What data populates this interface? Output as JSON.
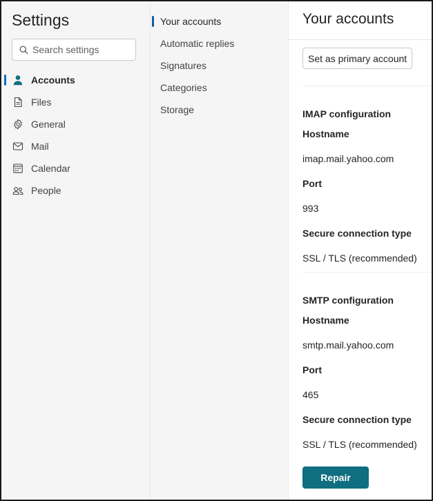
{
  "settings": {
    "title": "Settings",
    "search_placeholder": "Search settings",
    "nav": [
      {
        "label": "Accounts",
        "icon": "person-icon",
        "active": true
      },
      {
        "label": "Files",
        "icon": "file-icon"
      },
      {
        "label": "General",
        "icon": "gear-icon"
      },
      {
        "label": "Mail",
        "icon": "mail-icon"
      },
      {
        "label": "Calendar",
        "icon": "calendar-icon"
      },
      {
        "label": "People",
        "icon": "people-icon"
      }
    ]
  },
  "subnav": {
    "items": [
      {
        "label": "Your accounts",
        "active": true
      },
      {
        "label": "Automatic replies"
      },
      {
        "label": "Signatures"
      },
      {
        "label": "Categories"
      },
      {
        "label": "Storage"
      }
    ]
  },
  "main": {
    "title": "Your accounts",
    "primary_button": "Set as primary account",
    "imap": {
      "heading": "IMAP configuration",
      "hostname_label": "Hostname",
      "hostname": "imap.mail.yahoo.com",
      "port_label": "Port",
      "port": "993",
      "secure_label": "Secure connection type",
      "secure": "SSL / TLS (recommended)"
    },
    "smtp": {
      "heading": "SMTP configuration",
      "hostname_label": "Hostname",
      "hostname": "smtp.mail.yahoo.com",
      "port_label": "Port",
      "port": "465",
      "secure_label": "Secure connection type",
      "secure": "SSL / TLS (recommended)"
    },
    "repair_button": "Repair"
  },
  "colors": {
    "accent": "#0f6cbd",
    "repair_button": "#0f6e80",
    "pane_background": "#f5f5f5"
  }
}
